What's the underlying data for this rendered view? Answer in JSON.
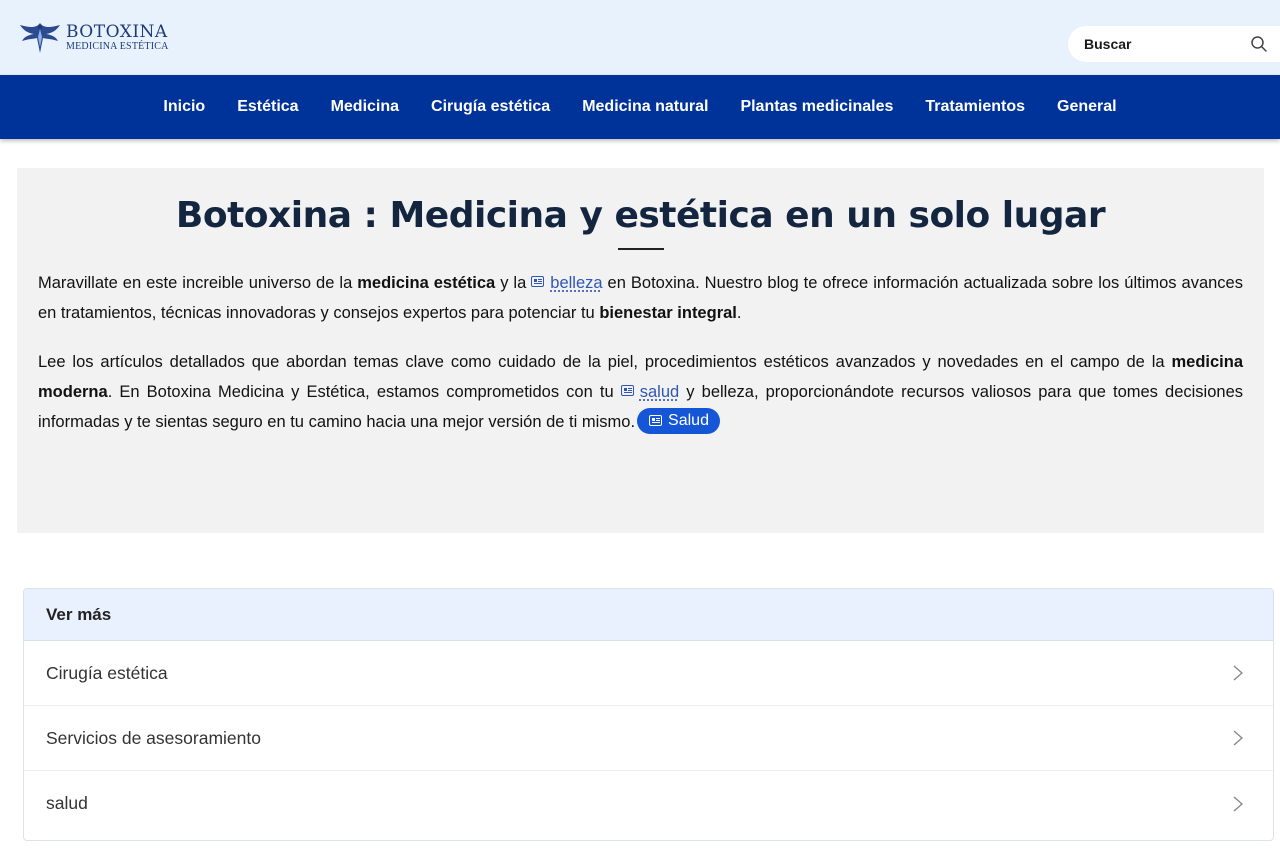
{
  "header": {
    "logo": {
      "title": "BOTOXINA",
      "subtitle": "MEDICINA ESTÉTICA"
    },
    "search": {
      "placeholder": "Buscar",
      "icon": "search-icon"
    }
  },
  "nav": {
    "items": [
      {
        "label": "Inicio"
      },
      {
        "label": "Estética"
      },
      {
        "label": "Medicina"
      },
      {
        "label": "Cirugía estética"
      },
      {
        "label": "Medicina natural"
      },
      {
        "label": "Plantas medicinales"
      },
      {
        "label": "Tratamientos"
      },
      {
        "label": "General"
      }
    ]
  },
  "hero": {
    "title": "Botoxina : Medicina y estética en un solo lugar",
    "p1": {
      "t1": "Maravillate en este increible universo de la ",
      "b1": "medicina estética",
      "t2": " y la ",
      "link": "belleza",
      "t3": " en Botoxina. Nuestro blog te ofrece información actualizada sobre los últimos avances en tratamientos, técnicas innovadoras y consejos expertos para potenciar tu ",
      "b2": "bienestar integral",
      "t4": "."
    },
    "p2": {
      "t1": "Lee los artículos detallados que abordan temas clave como cuidado de la piel, procedimientos estéticos avanzados y novedades en el campo de la ",
      "b1": "medicina moderna",
      "t2": ". En Botoxina Medicina y Estética, estamos comprometidos con tu ",
      "link": "salud",
      "t3": " y belleza, proporcionándote recursos valiosos para que tomes decisiones informadas y te sientas seguro en tu camino hacia una mejor versión de ti mismo.",
      "pill": "Salud"
    }
  },
  "more": {
    "header": "Ver más",
    "items": [
      {
        "label": "Cirugía estética"
      },
      {
        "label": "Servicios de asesoramiento"
      },
      {
        "label": "salud"
      }
    ]
  },
  "colors": {
    "topbar_bg": "#e8f2fd",
    "nav_bg": "#003399",
    "title_color": "#13253f",
    "link_color": "#2f55b5",
    "pill_bg": "#1556d6"
  }
}
